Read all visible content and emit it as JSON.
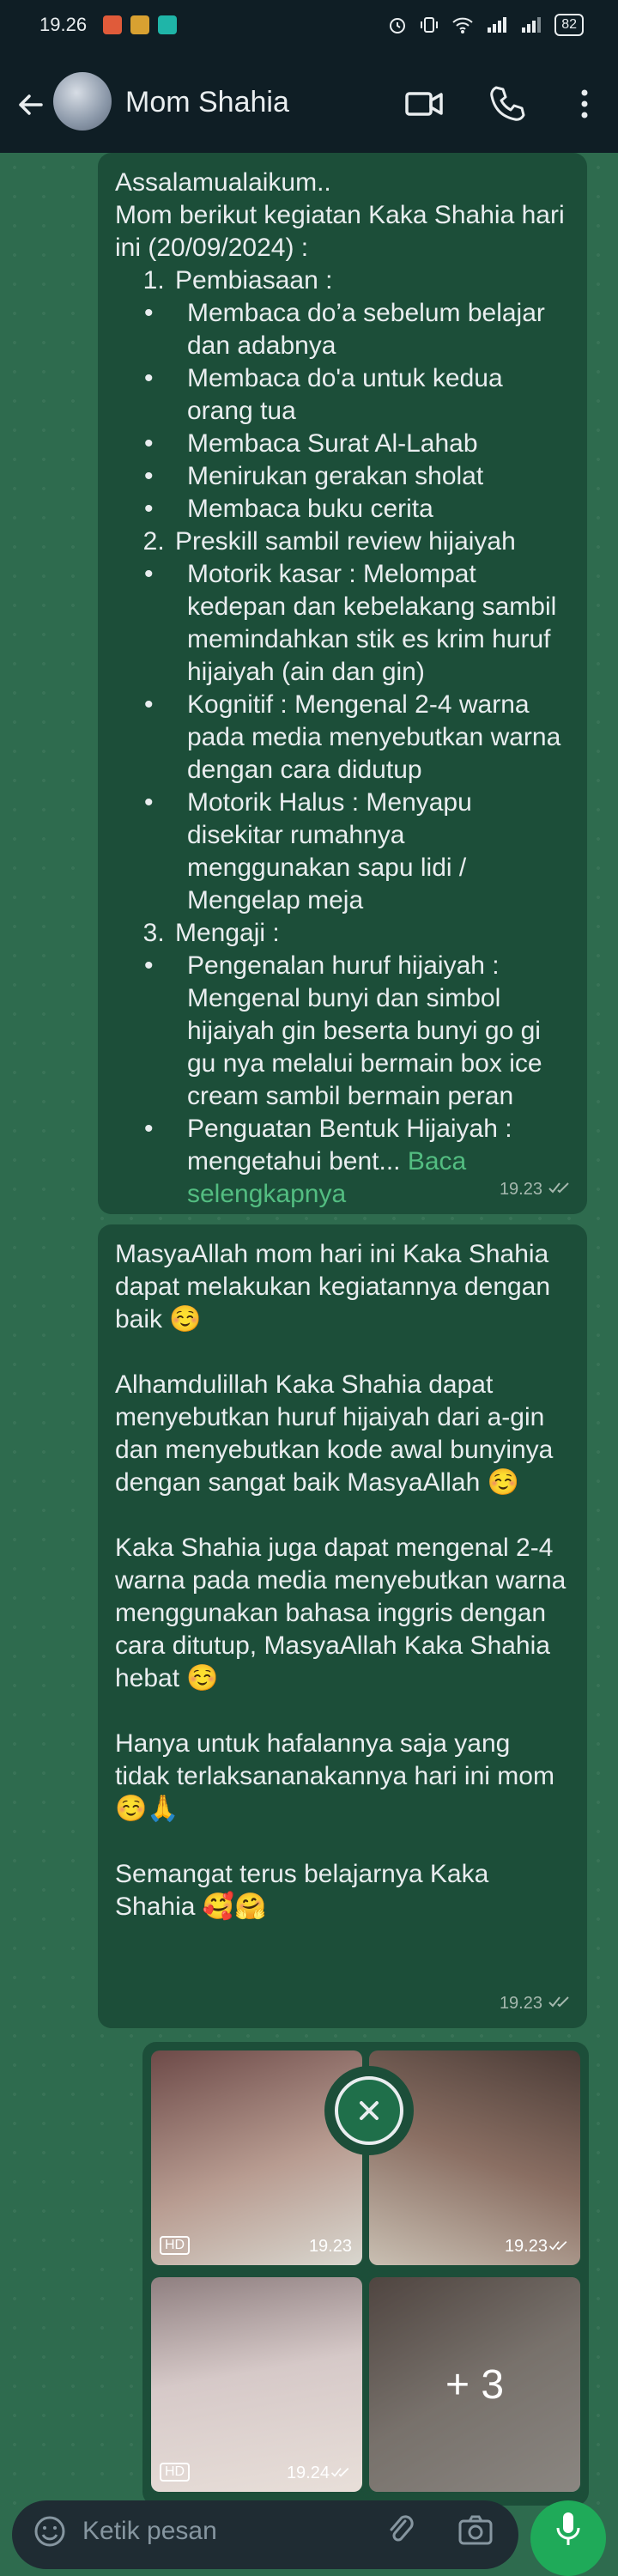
{
  "status_bar": {
    "time": "19.26",
    "battery": "82"
  },
  "header": {
    "contact_name": "Mom Shahia"
  },
  "messages": {
    "msg1": {
      "greeting": "Assalamualaikum..",
      "intro": "Mom berikut kegiatan Kaka Shahia hari ini (20/09/2024) :",
      "sections": [
        {
          "title": "Pembiasaan :",
          "items": [
            "Membaca do’a sebelum belajar dan adabnya",
            "Membaca do'a untuk kedua orang tua",
            "Membaca Surat Al-Lahab",
            "Menirukan gerakan sholat",
            "Membaca buku cerita"
          ]
        },
        {
          "title": "Preskill sambil review hijaiyah",
          "items": [
            "Motorik kasar :  Melompat kedepan dan kebelakang sambil memindahkan stik es krim huruf hijaiyah (ain dan gin)",
            "Kognitif :  Mengenal 2-4 warna pada media menyebutkan warna dengan cara didutup",
            "Motorik Halus :  Menyapu disekitar rumahnya menggunakan sapu lidi / Mengelap meja"
          ]
        },
        {
          "title": "Mengaji :",
          "items": [
            "Pengenalan huruf hijaiyah :  Mengenal bunyi dan simbol hijaiyah gin beserta bunyi go gi gu nya melalui bermain box ice cream sambil bermain peran"
          ]
        }
      ],
      "last_item": "Penguatan Bentuk Hijaiyah :  mengetahui bent...",
      "read_more": "Baca selengkapnya",
      "time": "19.23"
    },
    "msg2": {
      "paragraphs": [
        "MasyaAllah mom hari ini Kaka Shahia dapat melakukan kegiatannya dengan baik ☺️",
        "Alhamdulillah Kaka Shahia dapat menyebutkan huruf hijaiyah dari a-gin dan menyebutkan kode awal bunyinya dengan sangat baik MasyaAllah ☺️",
        "Kaka Shahia juga dapat mengenal 2-4 warna pada media menyebutkan warna menggunakan bahasa inggris dengan cara ditutup, MasyaAllah Kaka Shahia hebat ☺️",
        "Hanya untuk hafalannya saja yang tidak terlaksananakannya hari ini mom ☺️🙏",
        "Semangat terus belajarnya Kaka Shahia 🥰🤗"
      ],
      "time": "19.23"
    },
    "media": {
      "hd_label": "HD",
      "times": [
        "19.23",
        "19.23",
        "19.24"
      ],
      "more_count": "+ 3"
    }
  },
  "input": {
    "placeholder": "Ketik pesan"
  },
  "colors": {
    "bar_background": "#0f1e25",
    "chat_background": "#2e6b4e",
    "bubble": "#1c4e39",
    "accent": "#1faa59",
    "link": "#53bd81"
  },
  "icons": [
    "back-arrow-icon",
    "video-call-icon",
    "phone-icon",
    "more-vert-icon",
    "double-check-icon",
    "close-icon",
    "emoji-icon",
    "attach-icon",
    "camera-icon",
    "mic-icon"
  ]
}
